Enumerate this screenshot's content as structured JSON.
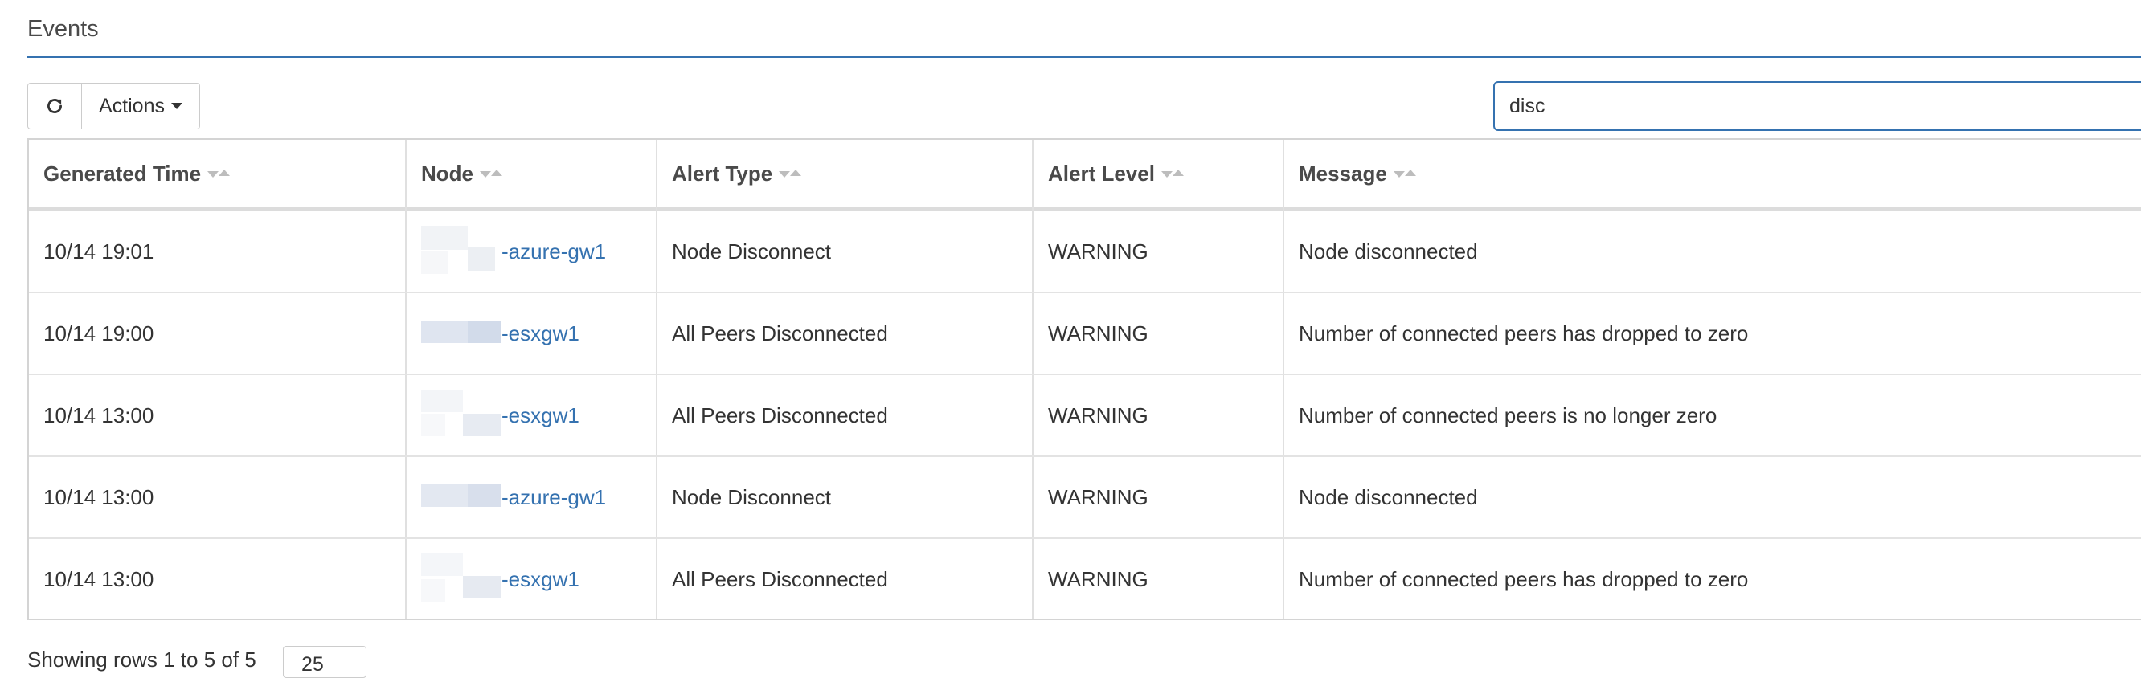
{
  "page": {
    "title": "Events"
  },
  "toolbar": {
    "refresh_icon": "refresh-icon",
    "actions_label": "Actions"
  },
  "search": {
    "value": "disc",
    "placeholder": ""
  },
  "table": {
    "columns": [
      "Generated Time",
      "Node",
      "Alert Type",
      "Alert Level",
      "Message"
    ],
    "rows": [
      {
        "time": "10/14 19:01",
        "node": "-azure-gw1",
        "alert_type": "Node Disconnect",
        "alert_level": "WARNING",
        "message": "Node disconnected"
      },
      {
        "time": "10/14 19:00",
        "node": "-esxgw1",
        "alert_type": "All Peers Disconnected",
        "alert_level": "WARNING",
        "message": "Number of connected peers has dropped to zero"
      },
      {
        "time": "10/14 13:00",
        "node": "-esxgw1",
        "alert_type": "All Peers Disconnected",
        "alert_level": "WARNING",
        "message": "Number of connected peers is no longer zero"
      },
      {
        "time": "10/14 13:00",
        "node": "-azure-gw1",
        "alert_type": "Node Disconnect",
        "alert_level": "WARNING",
        "message": "Node disconnected"
      },
      {
        "time": "10/14 13:00",
        "node": "-esxgw1",
        "alert_type": "All Peers Disconnected",
        "alert_level": "WARNING",
        "message": "Number of connected peers has dropped to zero"
      }
    ]
  },
  "footer": {
    "summary": "Showing rows 1 to 5 of 5",
    "page_size": "25"
  },
  "colors": {
    "accent": "#3572b0",
    "border": "#d4d4d4",
    "text": "#333333"
  }
}
